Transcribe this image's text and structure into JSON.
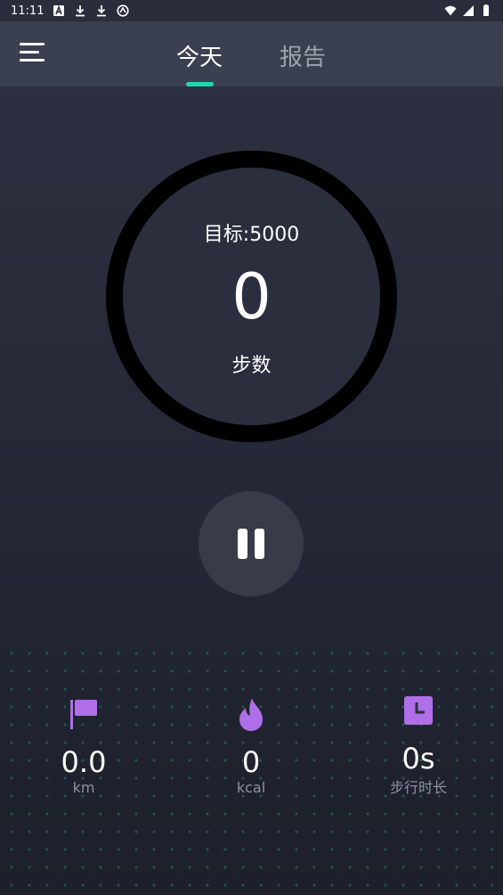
{
  "status_bar": {
    "time": "11:11",
    "icons_left": [
      "a-icon",
      "download-icon",
      "download-icon",
      "vpn-icon"
    ],
    "icons_right": [
      "wifi-icon",
      "signal-icon",
      "battery-icon"
    ]
  },
  "header": {
    "tabs": [
      {
        "label": "今天",
        "active": true
      },
      {
        "label": "报告",
        "active": false
      }
    ]
  },
  "progress": {
    "goal_label": "目标:5000",
    "steps_value": "0",
    "steps_label": "步数"
  },
  "stats": [
    {
      "icon": "flag-icon",
      "value": "0.0",
      "label": "km"
    },
    {
      "icon": "flame-icon",
      "value": "0",
      "label": "kcal"
    },
    {
      "icon": "clock-icon",
      "value": "0s",
      "label": "步行时长"
    }
  ],
  "colors": {
    "accent": "#1fd8a8",
    "icon_purple": "#b06ee8",
    "ring": "#000000",
    "header_bg": "#3b4050"
  }
}
